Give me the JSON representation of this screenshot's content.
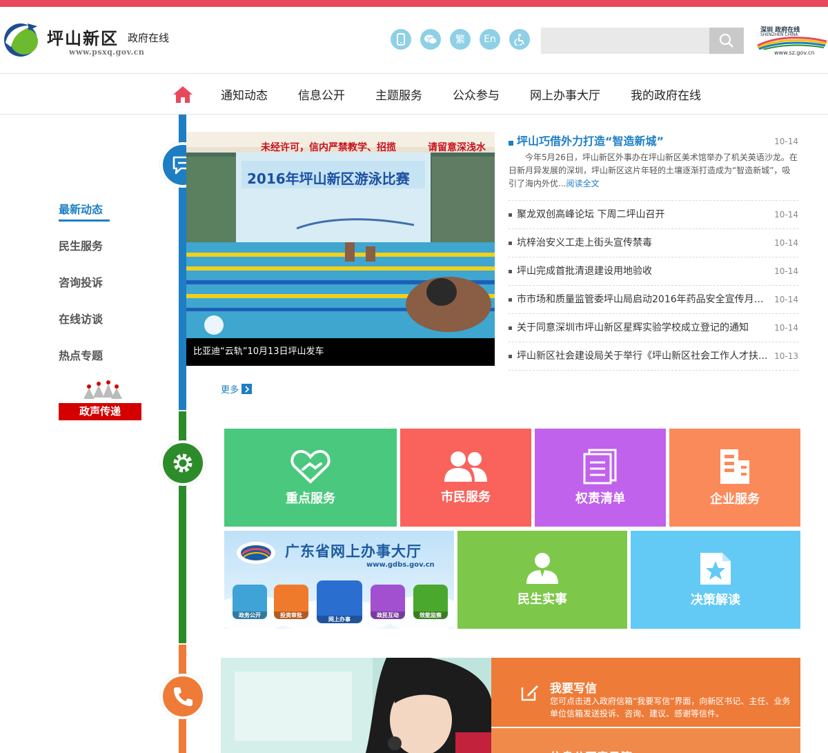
{
  "header": {
    "site_name": "坪山新区",
    "site_sub": "政府在线",
    "site_url": "www.psxq.gov.cn",
    "tools": [
      {
        "name": "mobile-icon",
        "glyph": "▯"
      },
      {
        "name": "wechat-icon",
        "glyph": "✉"
      },
      {
        "name": "traditional-chinese-icon",
        "glyph": "繁"
      },
      {
        "name": "english-icon",
        "glyph": "En"
      },
      {
        "name": "accessibility-icon",
        "glyph": "♿"
      }
    ],
    "search_placeholder": "",
    "sz_logo_line1": "深圳 政府在线",
    "sz_logo_line2": "SHENZHEN CHINA",
    "sz_logo_url": "www.sz.gov.cn",
    "accent_color": "#e8485c"
  },
  "nav": {
    "items": [
      "通知动态",
      "信息公开",
      "主题服务",
      "公众参与",
      "网上办事大厅",
      "我的政府在线"
    ]
  },
  "sidebar": {
    "items": [
      "最新动态",
      "民生服务",
      "咨询投诉",
      "在线访谈",
      "热点专题"
    ],
    "active_index": 0,
    "banner_label": "政声传递"
  },
  "hero": {
    "caption": "比亚迪“云轨”10月13日坪山发车",
    "banner_top": "未经许可，信内严禁教学、招揽",
    "banner_top_right": "请留意深浅水",
    "board_title": "2016年坪山新区游泳比赛"
  },
  "news": {
    "featured": {
      "title": "坪山巧借外力打造“智造新城”",
      "date": "10-14",
      "summary": "今年5月26日，坪山新区外事办在坪山新区美术馆举办了机关英语沙龙。在日新月异发展的深圳，坪山新区这片年轻的土壤逐渐打造成为“智造新城”，吸引了海内外优...",
      "read_more": "阅读全文"
    },
    "items": [
      {
        "title": "聚龙双创高峰论坛 下周二坪山召开",
        "date": "10-14"
      },
      {
        "title": "坑梓治安义工走上街头宣传禁毒",
        "date": "10-14"
      },
      {
        "title": "坪山完成首批清退建设用地验收",
        "date": "10-14"
      },
      {
        "title": "市市场和质量监管委坪山局启动2016年药品安全宣传月活...",
        "date": "10-14"
      },
      {
        "title": "关于同意深圳市坪山新区星辉实验学校成立登记的通知",
        "date": "10-14"
      },
      {
        "title": "坪山新区社会建设局关于举行《坪山新区社会工作人才扶...",
        "date": "10-13"
      }
    ],
    "more_label": "更多"
  },
  "services": {
    "key": "重点服务",
    "citizen": "市民服务",
    "power": "权责清单",
    "business": "企业服务",
    "life": "民生实事",
    "policy": "决策解读",
    "gd_title": "广东省网上办事大厅",
    "gd_url": "www.gdbs.gov.cn",
    "gd_buttons": [
      "政务公开",
      "投资审批",
      "网上办事",
      "政民互动",
      "效能监察"
    ]
  },
  "contact": {
    "letter_title": "我要写信",
    "letter_desc": "您可点击进入政府信箱“我要写信”界面，向新区书记、主任、业务单位信箱发送投诉、咨询、建议、感谢等信件。",
    "info_title": "信息公开意见箱"
  }
}
